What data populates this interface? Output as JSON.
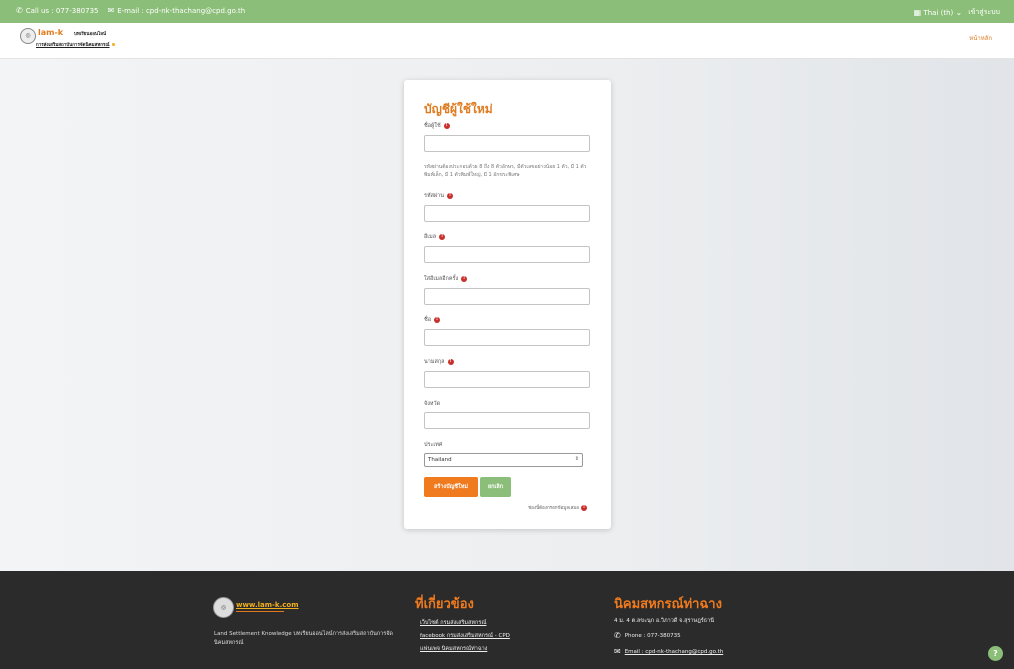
{
  "topbar": {
    "call": "Call us : 077-380735",
    "email": "E-mail : cpd-nk-thachang@cpd.go.th",
    "language": "Thai (th)",
    "login": "เข้าสู่ระบบ"
  },
  "navbar": {
    "logo_text": "lam-k",
    "logo_sub": "บทเรียนออนไลน์",
    "logo_sub2": "การส่งเสริมสถาบันการจัดนิคมสหกรณ์",
    "home": "หน้าหลัก"
  },
  "form": {
    "title": "บัญชีผู้ใช้ใหม่",
    "username_label": "ชื่อผู้ใช้",
    "password_hint": "รหัสผ่านต้องประกอบด้วย 8 ถึง 8 ตัวอักษร, มีตัวเลขอย่างน้อย 1 ตัว, มี 1 ตัวพิมพ์เล็ก, มี 1 ตัวพิมพ์ใหญ่, มี 1 อักขระพิเศษ",
    "password_label": "รหัสผ่าน",
    "email_label": "อีเมล",
    "email_again_label": "ใส่อีเมลอีกครั้ง",
    "firstname_label": "ชื่อ",
    "lastname_label": "นามสกุล",
    "province_label": "จังหวัด",
    "country_label": "ประเทศ",
    "country_value": "Thailand",
    "create_button": "สร้างบัญชีใหม่",
    "cancel_button": "ยกเลิก",
    "required_note": "ช่องนี้ต้องกรอกข้อมูลเสมอ"
  },
  "footer": {
    "site": "www.lam-k.com",
    "description": "Land Settlement Knowledge บทเรียนออนไลน์การส่งเสริมสถาบันการจัดนิคมสหกรณ์",
    "related_title": "ที่เกี่ยวข้อง",
    "links": [
      "เว็บไซต์ กรมส่งเสริมสหกรณ์",
      "facebook กรมส่งเสริมสหกรณ์ - CPD",
      "แฟนเพจ นิคมสหกรณ์ท่าฉาง"
    ],
    "org_title": "นิคมสหกรณ์ท่าฉาง",
    "address": "4 ม. 4 ต.ลขะนุก อ.วิภาวดี จ.สุราษฎร์ธานี",
    "phone": "Phone : 077-380735",
    "email": "Email : cpd-nk-thachang@cpd.go.th"
  },
  "colors": {
    "accent": "#8bbe78",
    "brand": "#f07a1e",
    "footer_bg": "#2b2b2b"
  },
  "icons": {
    "phone": "phone-icon",
    "mail": "mail-icon",
    "flag": "flag-icon",
    "help": "help-icon"
  }
}
